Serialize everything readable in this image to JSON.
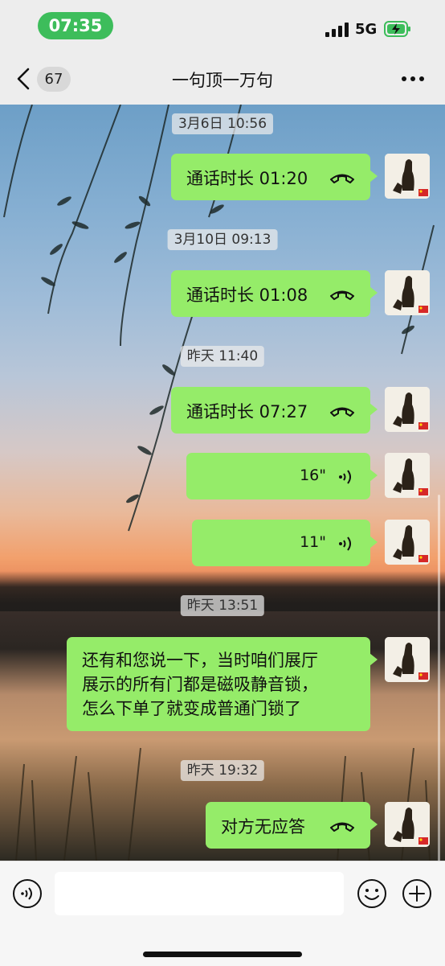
{
  "status_bar": {
    "time": "07:35",
    "network": "5G"
  },
  "nav": {
    "unread_count": "67",
    "title": "一句顶一万句"
  },
  "messages": {
    "ts1": "3月6日 10:56",
    "call1": "通话时长 01:20",
    "ts2": "3月10日 09:13",
    "call2": "通话时长 01:08",
    "ts3": "昨天 11:40",
    "call3": "通话时长 07:27",
    "voice1": "16\"",
    "voice2": "11\"",
    "ts4": "昨天 13:51",
    "text_lines": [
      "还有和您说一下，当时咱们展厅",
      "展示的所有门都是磁吸静音锁，",
      "怎么下单了就变成普通门锁了"
    ],
    "ts5": "昨天 19:32",
    "call4": "对方无应答"
  },
  "input": {
    "placeholder": ""
  },
  "colors": {
    "bubble": "#95ec69",
    "time_pill": "#3dbd5b",
    "background": "#ededed"
  },
  "icons": [
    "back-icon",
    "more-icon",
    "phone-hangup-icon",
    "voice-wave-icon",
    "voice-input-icon",
    "emoji-icon",
    "plus-icon",
    "signal-icon",
    "battery-charging-icon"
  ]
}
